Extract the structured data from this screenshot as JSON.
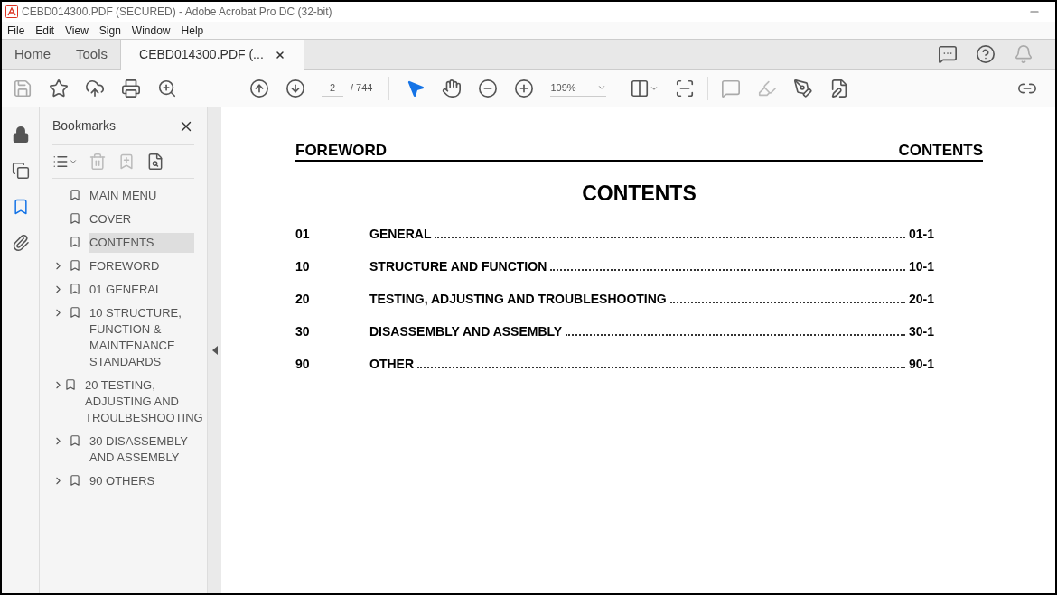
{
  "window": {
    "title": "CEBD014300.PDF (SECURED) - Adobe Acrobat Pro DC (32-bit)"
  },
  "menu": [
    "File",
    "Edit",
    "View",
    "Sign",
    "Window",
    "Help"
  ],
  "tabs": [
    {
      "label": "Home",
      "selected": false,
      "kind": "nav"
    },
    {
      "label": "Tools",
      "selected": false,
      "kind": "nav"
    },
    {
      "label": "CEBD014300.PDF (...",
      "selected": true,
      "kind": "doc"
    }
  ],
  "toolbar": {
    "page": "2",
    "page_total": "/ 744",
    "zoom": "109%"
  },
  "bookmarks": {
    "title": "Bookmarks",
    "items": [
      {
        "label": "MAIN MENU",
        "kind": "leaf",
        "selected": false
      },
      {
        "label": "COVER",
        "kind": "leaf",
        "selected": false
      },
      {
        "label": "CONTENTS",
        "kind": "leaf",
        "selected": true
      },
      {
        "label": "FOREWORD",
        "kind": "parent",
        "selected": false
      },
      {
        "label": "01 GENERAL",
        "kind": "parent",
        "selected": false
      },
      {
        "label": "10 STRUCTURE, FUNCTION & MAINTENANCE STANDARDS",
        "kind": "parent",
        "selected": false
      },
      {
        "label": "20 TESTING, ADJUSTING AND TROULBESHOOTING",
        "kind": "parent",
        "selected": false
      },
      {
        "label": "30 DISASSEMBLY AND ASSEMBLY",
        "kind": "parent",
        "selected": false
      },
      {
        "label": "90 OTHERS",
        "kind": "parent",
        "selected": false
      }
    ]
  },
  "document": {
    "header_left": "FOREWORD",
    "header_right": "CONTENTS",
    "title": "CONTENTS",
    "rows": [
      {
        "number": "01",
        "title": "GENERAL",
        "page": "01-1"
      },
      {
        "number": "10",
        "title": "STRUCTURE AND FUNCTION",
        "page": "10-1"
      },
      {
        "number": "20",
        "title": "TESTING, ADJUSTING AND TROUBLESHOOTING",
        "page": "20-1"
      },
      {
        "number": "30",
        "title": "DISASSEMBLY AND ASSEMBLY",
        "page": "30-1"
      },
      {
        "number": "90",
        "title": "OTHER",
        "page": "90-1"
      }
    ]
  }
}
